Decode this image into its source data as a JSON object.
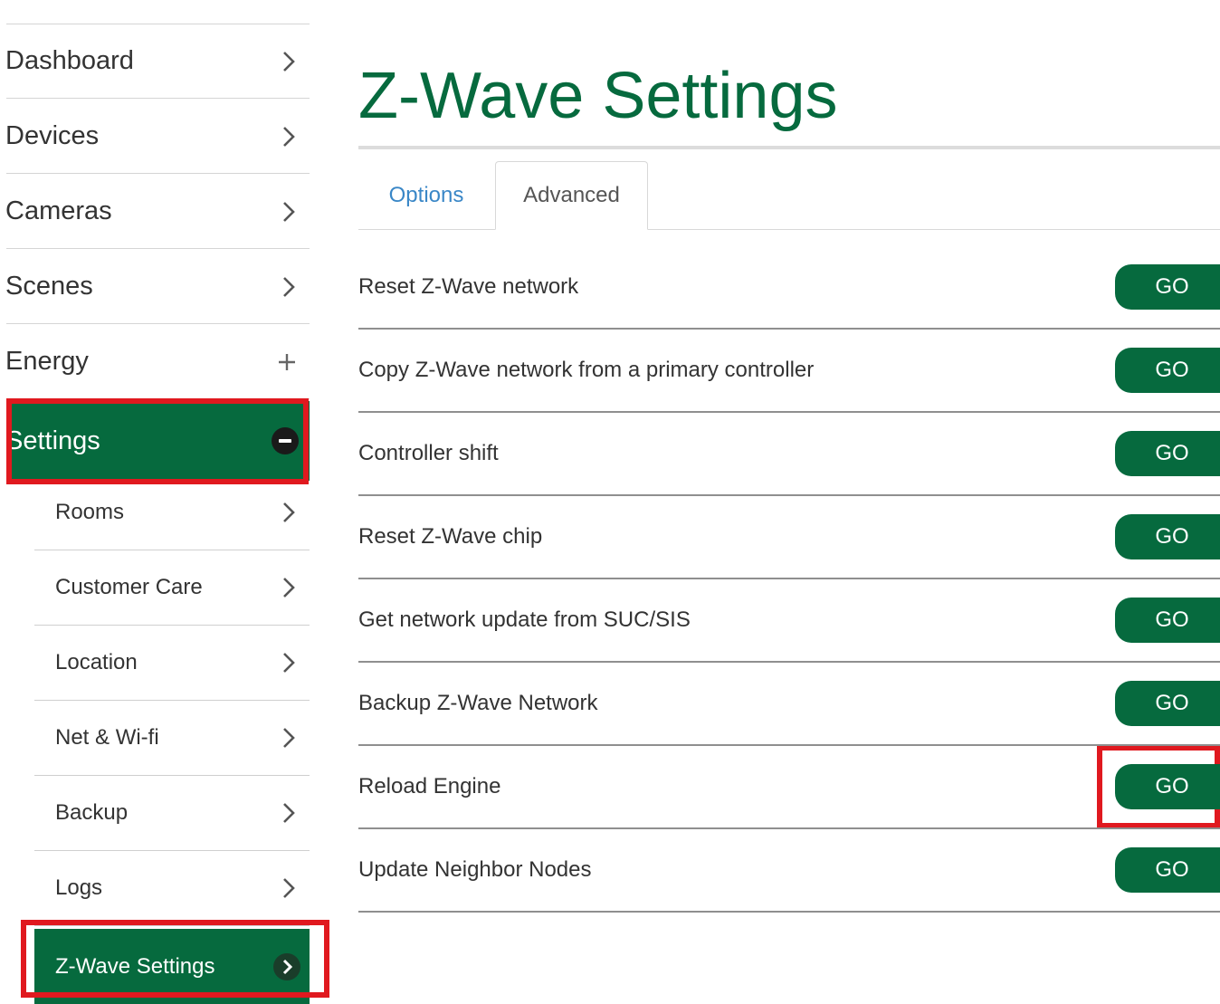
{
  "sidebar": {
    "items": [
      {
        "label": "Dashboard",
        "icon": "chevron-right-icon"
      },
      {
        "label": "Devices",
        "icon": "chevron-right-icon"
      },
      {
        "label": "Cameras",
        "icon": "chevron-right-icon"
      },
      {
        "label": "Scenes",
        "icon": "chevron-right-icon"
      },
      {
        "label": "Energy",
        "icon": "plus-icon"
      },
      {
        "label": "Settings",
        "icon": "minus-circle-icon"
      }
    ],
    "sub_items": [
      {
        "label": "Rooms"
      },
      {
        "label": "Customer Care"
      },
      {
        "label": "Location"
      },
      {
        "label": "Net & Wi-fi"
      },
      {
        "label": "Backup"
      },
      {
        "label": "Logs"
      },
      {
        "label": "Z-Wave Settings"
      }
    ]
  },
  "main": {
    "title": "Z-Wave Settings",
    "tabs": [
      {
        "label": "Options"
      },
      {
        "label": "Advanced"
      }
    ],
    "rows": [
      {
        "label": "Reset Z-Wave network",
        "button": "GO"
      },
      {
        "label": "Copy Z-Wave network from a primary controller",
        "button": "GO"
      },
      {
        "label": "Controller shift",
        "button": "GO"
      },
      {
        "label": "Reset Z-Wave chip",
        "button": "GO"
      },
      {
        "label": "Get network update from SUC/SIS",
        "button": "GO"
      },
      {
        "label": "Backup Z-Wave Network",
        "button": "GO"
      },
      {
        "label": "Reload Engine",
        "button": "GO"
      },
      {
        "label": "Update Neighbor Nodes",
        "button": "GO"
      }
    ]
  },
  "colors": {
    "brand_green": "#066a3e",
    "tab_link_blue": "#3a87c7",
    "highlight_red": "#e0191f"
  }
}
